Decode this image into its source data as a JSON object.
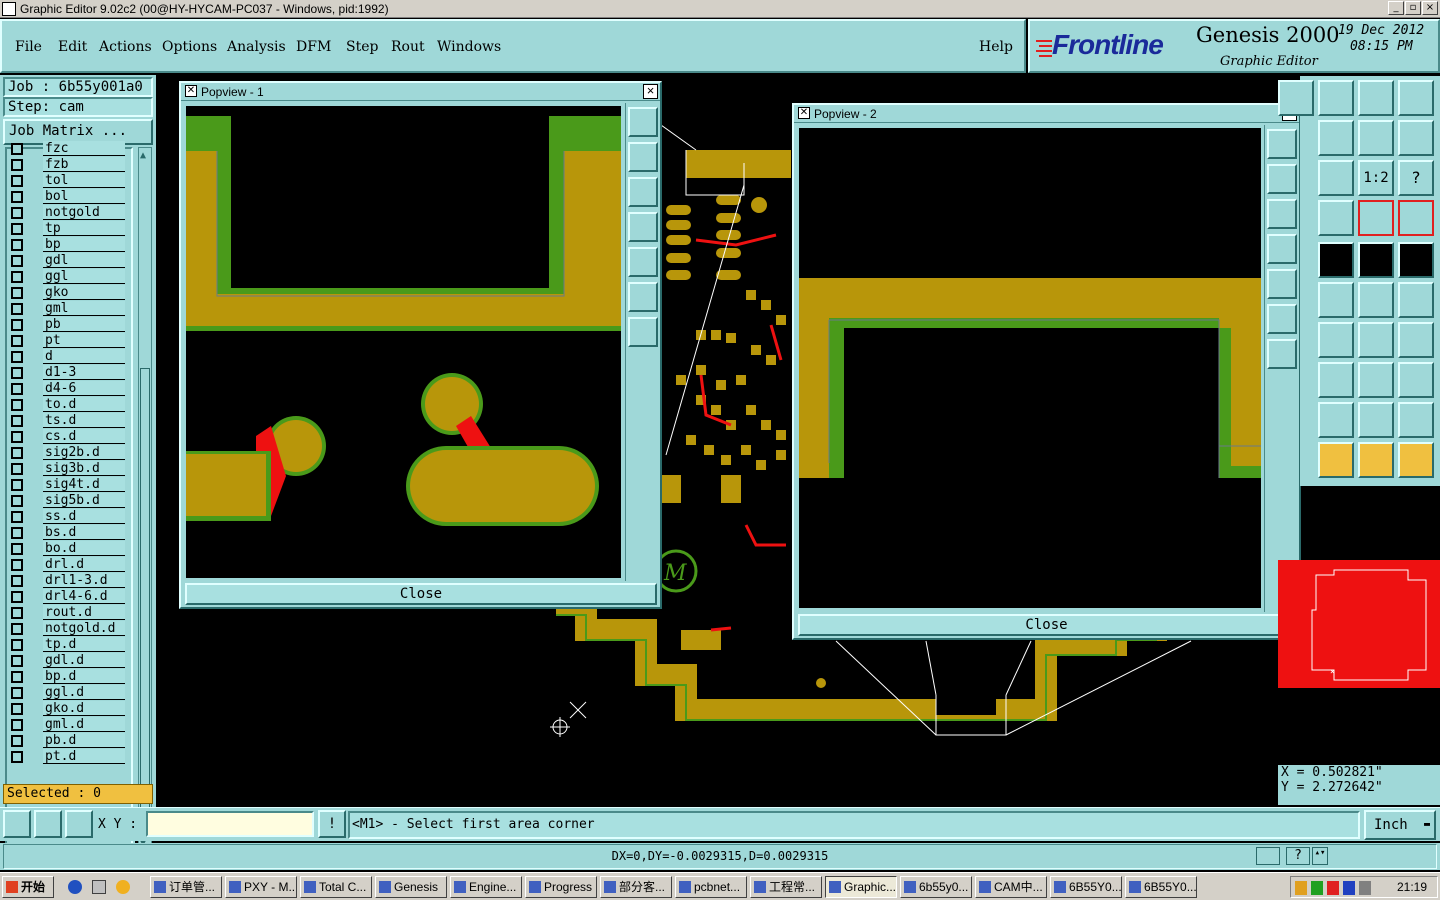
{
  "window": {
    "title": "Graphic Editor 9.02c2 (00@HY-HYCAM-PC037 - Windows, pid:1992)",
    "min": "_",
    "max": "▫",
    "close": "×"
  },
  "menu": [
    "File",
    "Edit",
    "Actions",
    "Options",
    "Analysis",
    "DFM",
    "Step",
    "Rout",
    "Windows"
  ],
  "help_label": "Help",
  "logo": {
    "brand": "Frontline",
    "product": "Genesis 2000",
    "subtitle": "Graphic Editor",
    "date": "19 Dec 2012",
    "time": "08:15 PM"
  },
  "job": {
    "job_label": "Job : 6b55y001a0",
    "step_label": "Step: cam",
    "matrix_button": "Job Matrix ..."
  },
  "layers": [
    "fzb",
    "tol",
    "bol",
    "notgold",
    "tp",
    "bp",
    "gdl",
    "ggl",
    "gko",
    "gml",
    "pb",
    "pt",
    "d",
    "d1-3",
    "d4-6",
    "to.d",
    "ts.d",
    "cs.d",
    "sig2b.d",
    "sig3b.d",
    "sig4t.d",
    "sig5b.d",
    "ss.d",
    "bs.d",
    "bo.d",
    "drl.d",
    "drl1-3.d",
    "drl4-6.d",
    "rout.d",
    "notgold.d",
    "tp.d",
    "gdl.d",
    "bp.d",
    "ggl.d",
    "gko.d",
    "gml.d",
    "pb.d",
    "pt.d"
  ],
  "layers_partial_top": "fzc",
  "selected": "Selected : 0",
  "popview1": {
    "title": "Popview - 1",
    "close_label": "Close"
  },
  "popview2": {
    "title": "Popview - 2",
    "close_label": "Close"
  },
  "coords": {
    "x": "X = 0.502821\"",
    "y": "Y = 2.272642\""
  },
  "cmd": {
    "xy_label": "X Y :",
    "input_value": "",
    "prompt": "<M1> - Select first area corner",
    "unit": "Inch"
  },
  "status": {
    "measure": "DX=0,DY=-0.0029315,D=0.0029315",
    "help_glyph": "?"
  },
  "taskbar": {
    "start": "开始",
    "items": [
      "订单管...",
      "PXY - M...",
      "Total C...",
      "Genesis",
      "Engine...",
      "Progress",
      "部分客...",
      "pcbnet...",
      "工程常...",
      "Graphic...",
      "6b55y0...",
      "CAM中...",
      "6B55Y0...",
      "6B55Y0..."
    ],
    "clock": "21:19"
  },
  "colors": {
    "panel": "#9fd8d8",
    "copper": "#b8960a",
    "mask_green": "#4a9a1a",
    "trace_red": "#ee1111"
  }
}
